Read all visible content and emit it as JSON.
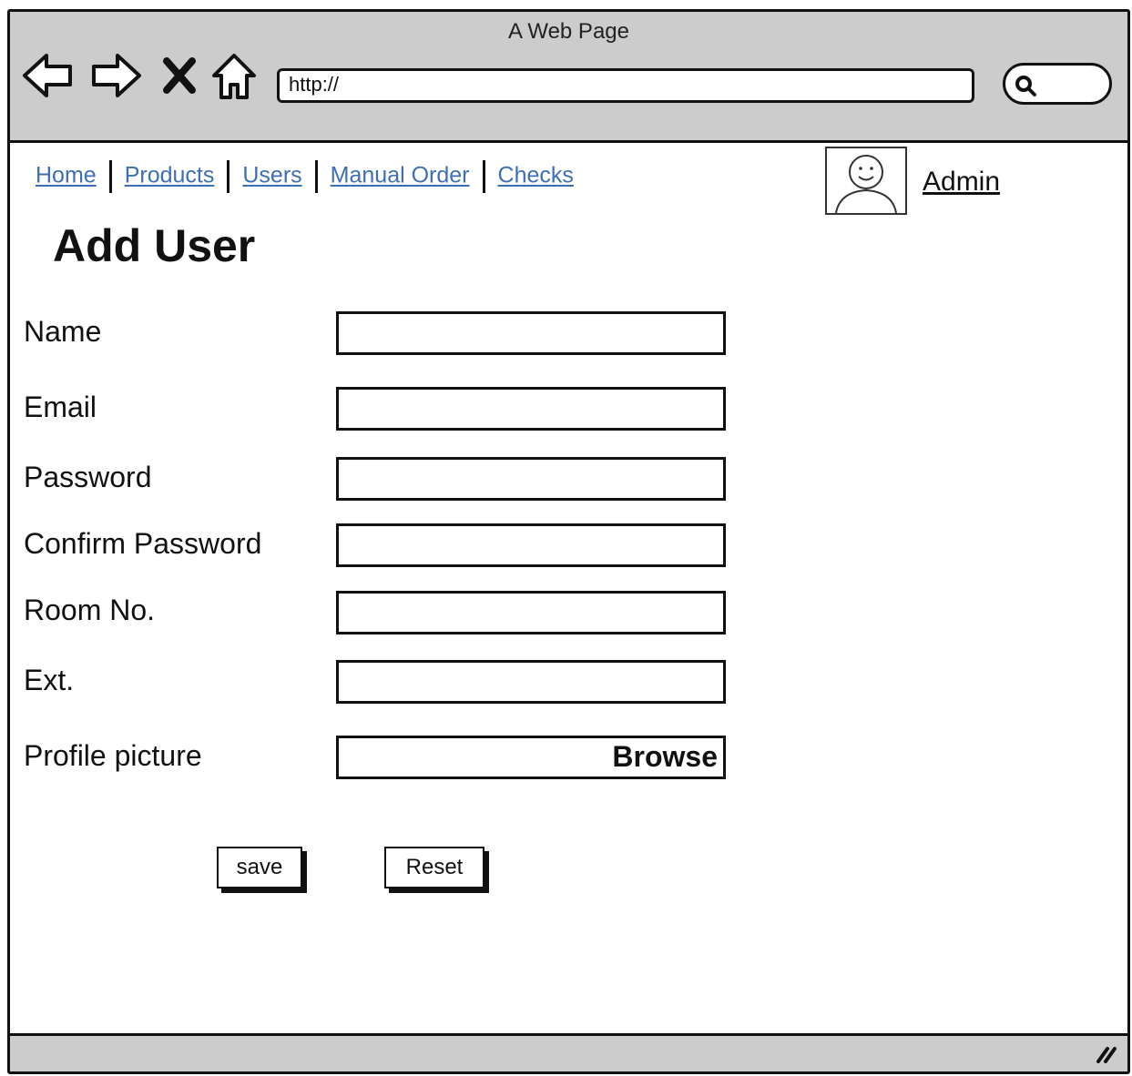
{
  "window": {
    "title": "A Web Page"
  },
  "browser": {
    "url": "http://",
    "icons": [
      "back-arrow-icon",
      "forward-arrow-icon",
      "close-x-icon",
      "home-icon",
      "search-icon"
    ]
  },
  "nav": {
    "links": [
      "Home",
      "Products",
      "Users",
      "Manual Order",
      "Checks"
    ]
  },
  "user": {
    "name": "Admin"
  },
  "page": {
    "title": "Add User"
  },
  "form": {
    "fields": [
      {
        "label": "Name",
        "value": ""
      },
      {
        "label": "Email",
        "value": ""
      },
      {
        "label": "Password",
        "value": ""
      },
      {
        "label": "Confirm Password",
        "value": ""
      },
      {
        "label": "Room No.",
        "value": ""
      },
      {
        "label": "Ext.",
        "value": ""
      },
      {
        "label": "Profile picture",
        "value": "",
        "browse_label": "Browse"
      }
    ],
    "save_label": "save",
    "reset_label": "Reset"
  },
  "colors": {
    "chrome": "#cccccc",
    "link": "#3c6fb5",
    "border": "#111111"
  }
}
